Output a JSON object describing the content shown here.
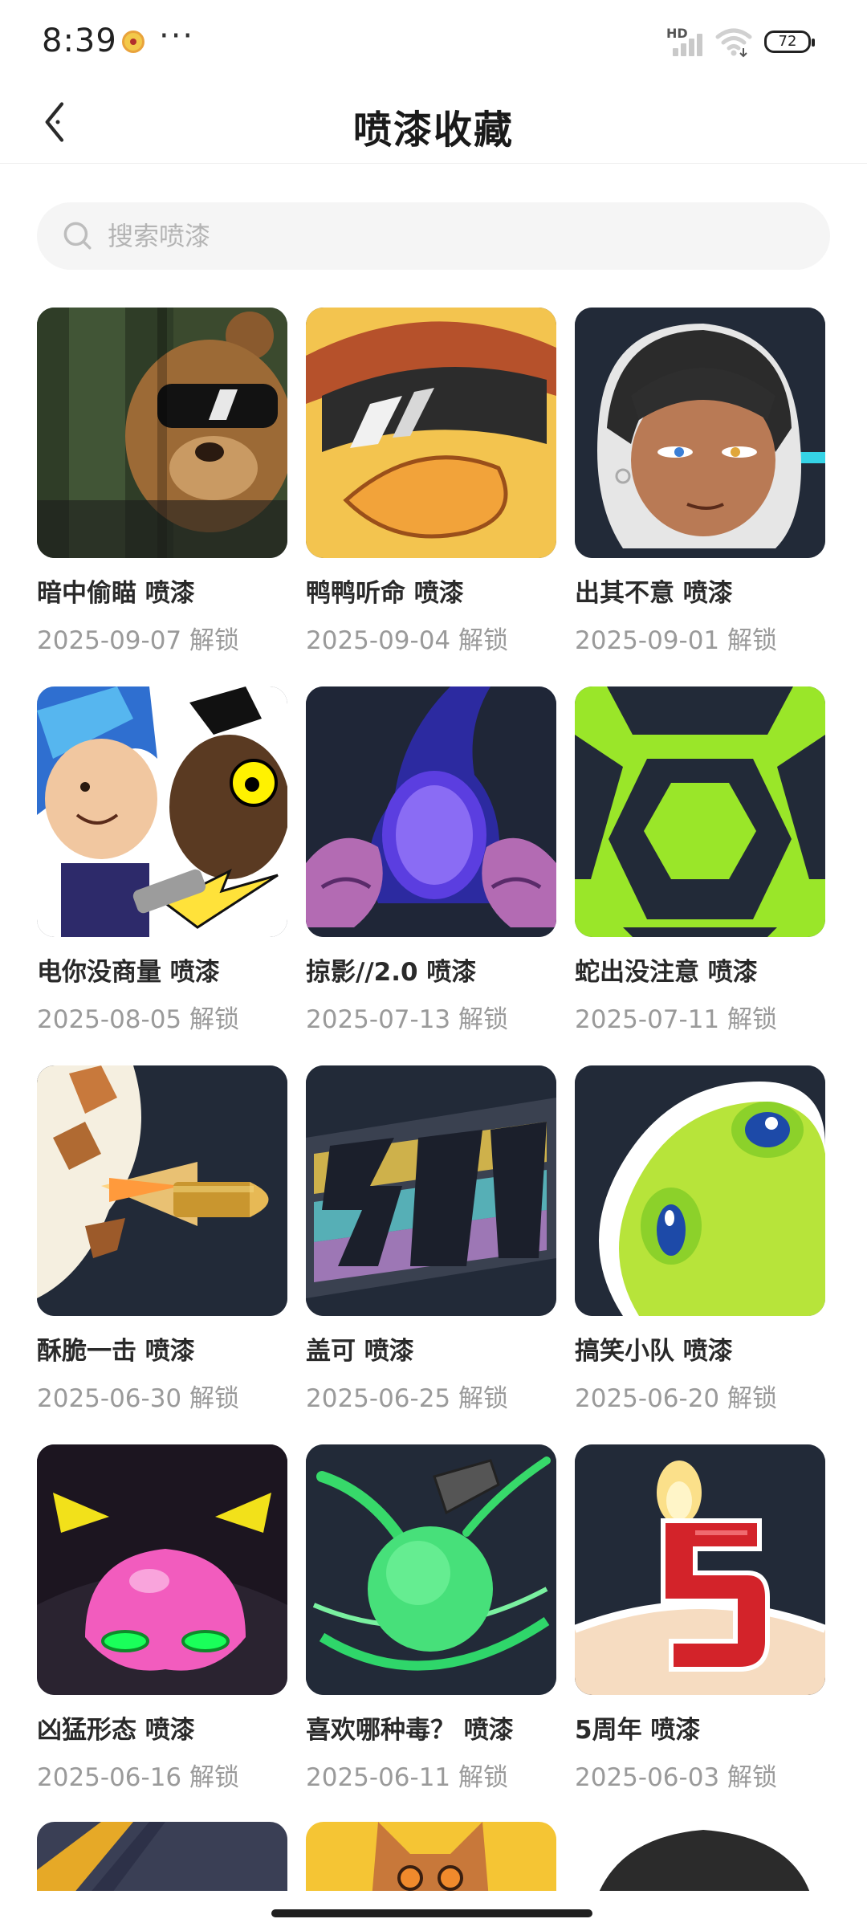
{
  "status_bar": {
    "time": "8:39",
    "more": "···",
    "network": "HD",
    "battery": "72"
  },
  "header": {
    "title": "喷漆收藏"
  },
  "search": {
    "placeholder": "搜索喷漆",
    "value": ""
  },
  "sprays": [
    {
      "title": "暗中偷瞄 喷漆",
      "date": "2025-09-07 解锁",
      "icon": "bear-sunglasses-art"
    },
    {
      "title": "鸭鸭听命 喷漆",
      "date": "2025-09-04 解锁",
      "icon": "duck-sunglasses-art"
    },
    {
      "title": "出其不意 喷漆",
      "date": "2025-09-01 解锁",
      "icon": "agent-portrait-art"
    },
    {
      "title": "电你没商量 喷漆",
      "date": "2025-08-05 解锁",
      "icon": "electric-duo-art"
    },
    {
      "title": "掠影//2.0 喷漆",
      "date": "2025-07-13 解锁",
      "icon": "purple-orb-art"
    },
    {
      "title": "蛇出没注意 喷漆",
      "date": "2025-07-11 解锁",
      "icon": "green-hexagon-art"
    },
    {
      "title": "酥脆一击 喷漆",
      "date": "2025-06-30 解锁",
      "icon": "bullet-art"
    },
    {
      "title": "盖可 喷漆",
      "date": "2025-06-25 解锁",
      "icon": "graffiti-text-art"
    },
    {
      "title": "搞笑小队 喷漆",
      "date": "2025-06-20 解锁",
      "icon": "green-blob-art"
    },
    {
      "title": "凶猛形态 喷漆",
      "date": "2025-06-16 解锁",
      "icon": "pink-blob-art"
    },
    {
      "title": "喜欢哪种毒？ 喷漆",
      "date": "2025-06-11 解锁",
      "icon": "green-orb-art"
    },
    {
      "title": "5周年 喷漆",
      "date": "2025-06-03 解锁",
      "icon": "birthday-candle-art"
    }
  ],
  "colors": {
    "accent_dark": "#222a38",
    "title_text": "#2a2a2a",
    "date_text": "#9a9a9a",
    "search_bg": "#f5f5f5"
  }
}
